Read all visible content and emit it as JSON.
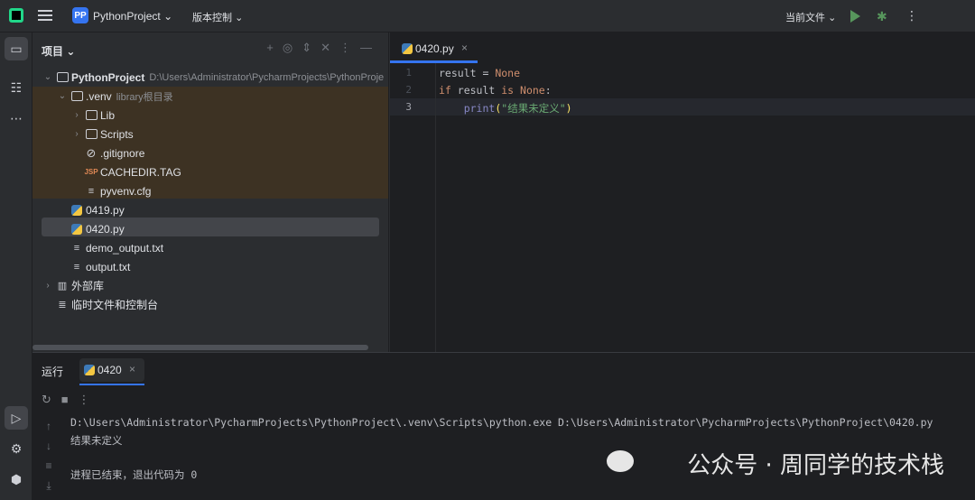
{
  "topbar": {
    "project_badge": "PP",
    "project_name": "PythonProject",
    "vcs_label": "版本控制",
    "current_file_label": "当前文件"
  },
  "project_panel": {
    "title": "项目",
    "tree": {
      "root_name": "PythonProject",
      "root_path": "D:\\Users\\Administrator\\PycharmProjects\\PythonProje",
      "venv_name": ".venv",
      "venv_hint": "library根目录",
      "lib": "Lib",
      "scripts": "Scripts",
      "gitignore": ".gitignore",
      "cachedir": "CACHEDIR.TAG",
      "pyvenv": "pyvenv.cfg",
      "file_0419": "0419.py",
      "file_0420": "0420.py",
      "demo_output": "demo_output.txt",
      "output": "output.txt",
      "external_libs": "外部库",
      "scratches": "临时文件和控制台"
    }
  },
  "editor": {
    "tab_label": "0420.py",
    "line_numbers": [
      "1",
      "2",
      "3"
    ],
    "lines": {
      "l1_var": "result",
      "l1_op": " = ",
      "l1_val": "None",
      "l2_kw": "if",
      "l2_var": " result ",
      "l2_is": "is",
      "l2_none": " None",
      "l2_colon": ":",
      "l3_indent": "    ",
      "l3_fn": "print",
      "l3_open": "(",
      "l3_str": "\"结果未定义\"",
      "l3_close": ")"
    }
  },
  "run_panel": {
    "title": "运行",
    "tab_label": "0420",
    "output": [
      "D:\\Users\\Administrator\\PycharmProjects\\PythonProject\\.venv\\Scripts\\python.exe D:\\Users\\Administrator\\PycharmProjects\\PythonProject\\0420.py",
      "结果未定义",
      "",
      "进程已结束，退出代码为 0"
    ]
  },
  "watermark": "公众号 · 周同学的技术栈",
  "colors": {
    "accent": "#3574f0",
    "run_green": "#57965c",
    "venv_highlight": "#3d3223"
  }
}
